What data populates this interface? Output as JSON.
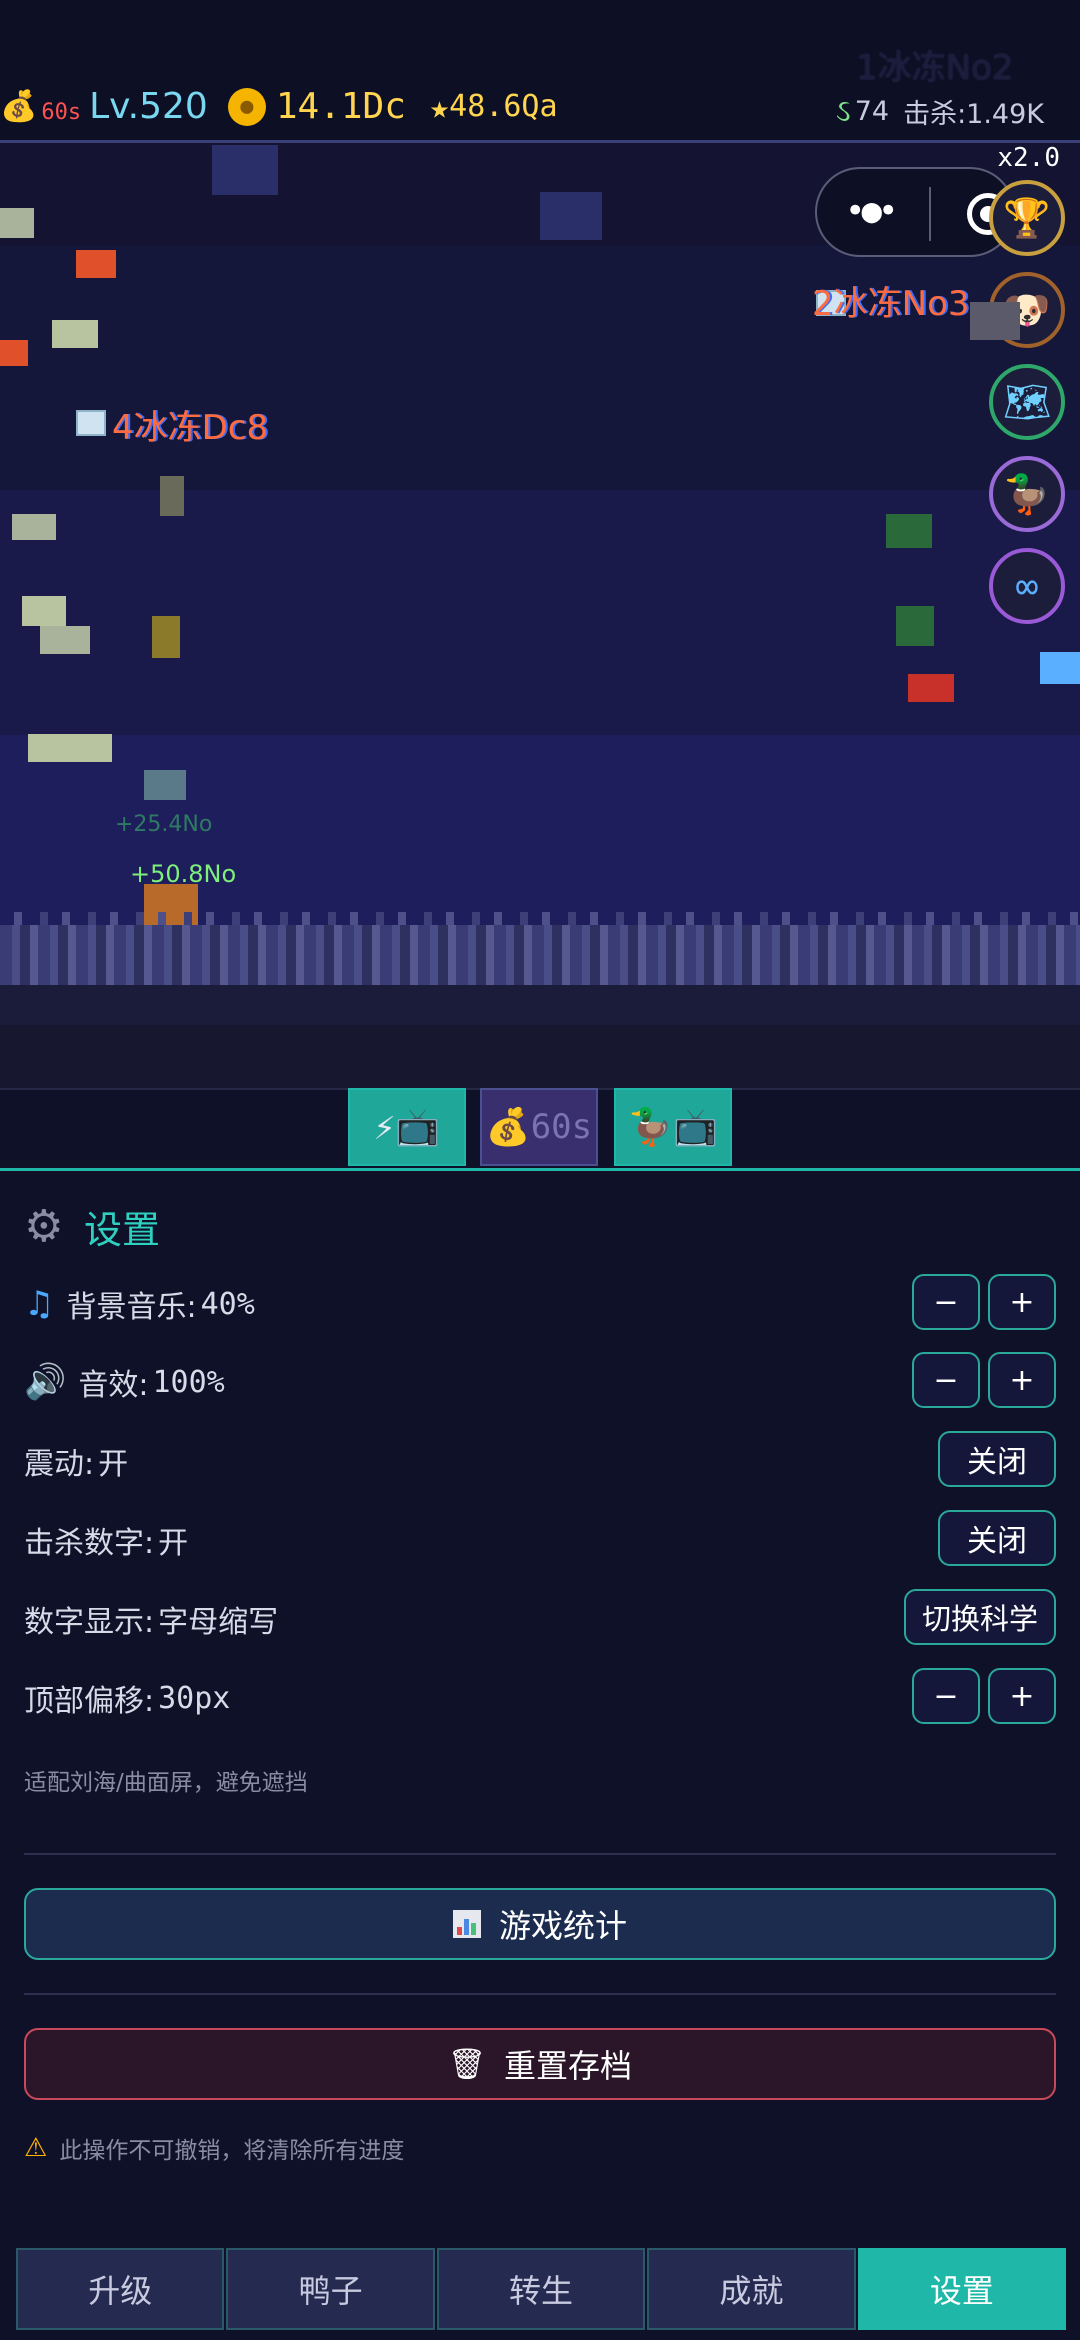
{
  "hud": {
    "money_icon": "money-bag",
    "money_timer": "60s",
    "level": "Lv.520",
    "gold": "14.1Dc",
    "star_icon": "★",
    "stars": "48.6Qa",
    "snake_icon": "snake",
    "combo": "74",
    "kills": "击杀:1.49K"
  },
  "game": {
    "multiplier": "x2.0",
    "floating_texts": [
      "2冰冻No3",
      "4冰冻Dc8",
      "1冰冻No2",
      "+25.4No",
      "+50.8No"
    ]
  },
  "buffs": {
    "speed_ad": "⚡📺",
    "money_timer": "60s",
    "duck_ad": "🦆📺"
  },
  "settings": {
    "title": "设置",
    "bgm_label": "背景音乐:",
    "bgm_value": "40%",
    "sfx_label": "音效:",
    "sfx_value": "100%",
    "vibration_label": "震动:",
    "vibration_value": "开",
    "vibration_button": "关闭",
    "killnum_label": "击杀数字:",
    "killnum_value": "开",
    "killnum_button": "关闭",
    "numfmt_label": "数字显示:",
    "numfmt_value": "字母缩写",
    "numfmt_button": "切换科学",
    "offset_label": "顶部偏移:",
    "offset_value": "30px",
    "minus": "−",
    "plus": "+",
    "hint": "适配刘海/曲面屏，避免遮挡",
    "stats_button": "游戏统计",
    "reset_button": "重置存档",
    "warning": "此操作不可撤销，将清除所有进度"
  },
  "nav": {
    "tabs": [
      "升级",
      "鸭子",
      "转生",
      "成就",
      "设置"
    ],
    "active": "设置"
  },
  "colors": {
    "accent": "#1fb8a8",
    "gold": "#ffd54f",
    "danger": "#c84a5a",
    "bg": "#0f1128"
  }
}
